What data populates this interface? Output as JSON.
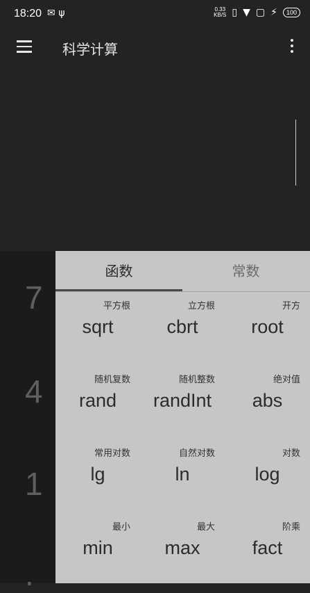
{
  "status_bar": {
    "time": "18:20",
    "left_icons": [
      "mail-icon",
      "usb-icon"
    ],
    "net_speed_value": "0.33",
    "net_speed_unit": "KB/S",
    "battery": "100"
  },
  "toolbar": {
    "title": "科学计算"
  },
  "keypad": {
    "digits": [
      "7",
      "4",
      "1",
      "."
    ]
  },
  "panel": {
    "tabs": [
      {
        "label": "函数",
        "active": true
      },
      {
        "label": "常数",
        "active": false
      }
    ],
    "functions": [
      {
        "label": "平方根",
        "fn": "sqrt"
      },
      {
        "label": "立方根",
        "fn": "cbrt"
      },
      {
        "label": "开方",
        "fn": "root"
      },
      {
        "label": "随机复数",
        "fn": "rand"
      },
      {
        "label": "随机整数",
        "fn": "randInt"
      },
      {
        "label": "绝对值",
        "fn": "abs"
      },
      {
        "label": "常用对数",
        "fn": "lg"
      },
      {
        "label": "自然对数",
        "fn": "ln"
      },
      {
        "label": "对数",
        "fn": "log"
      },
      {
        "label": "最小",
        "fn": "min"
      },
      {
        "label": "最大",
        "fn": "max"
      },
      {
        "label": "阶乘",
        "fn": "fact"
      }
    ]
  },
  "colors": {
    "background": "#232323",
    "panel": "#c6c6c6",
    "keypad": "#1b1b1b",
    "digit": "#5f5f5f"
  }
}
